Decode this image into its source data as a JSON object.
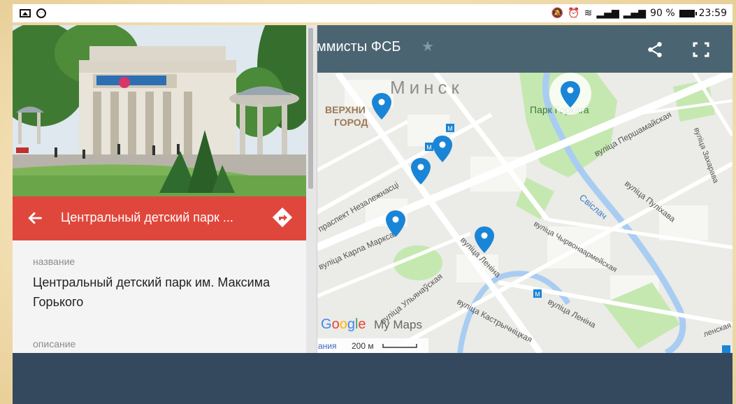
{
  "status_bar": {
    "icons": [
      "gallery-icon",
      "circle-dots-icon",
      "mute-icon",
      "alarm-icon",
      "wifi-icon",
      "signal-icon",
      "signal-icon",
      "battery-icon"
    ],
    "battery": "90 %",
    "time": "23:59"
  },
  "map_header": {
    "title": "ммисты ФСБ",
    "icons": [
      "star-icon",
      "share-icon",
      "fullscreen-icon"
    ]
  },
  "map": {
    "labels": {
      "city": "Минск",
      "district_line1": "ВЕРХНИ",
      "district_line2": "ГОРОД",
      "park": "Парк Горкага",
      "street_pershamaiskaya": "вуліца Першамайская",
      "street_zakharava": "вуліца Захарава",
      "street_pulikhava": "вуліца Пуліхава",
      "river": "Свіслач",
      "street_chyrvonaarmeiskaya": "вуліца Чырвонаармейская",
      "prospekt": "праспект Незалежнасці",
      "street_karla_marksa": "вуліца Карла Маркса",
      "street_lenina_1": "вуліца Леніна",
      "street_ulyanauskaya": "вуліца Ульянаўская",
      "street_lenina_2": "вуліца Леніна",
      "street_kastrychnitskaya": "вуліца Кастрычніцкая",
      "street_edge": "ленская",
      "metro": "М",
      "attribution_partial": "ания",
      "scale": "200 м"
    },
    "google": {
      "g1": "G",
      "o1": "o",
      "o2": "o",
      "g2": "g",
      "l": "l",
      "e": "e"
    },
    "my_maps": "My Maps",
    "markers": 6
  },
  "panel": {
    "place_title": "Центральный детский парк ...",
    "name_label": "название",
    "name_value": "Центральный детский парк им. Максима Горького",
    "description_label": "описание"
  },
  "colors": {
    "map_header": "#4b6472",
    "title_bar": "#e0473c",
    "bottom_bar": "#34495e",
    "marker": "#1a85d6",
    "park": "#c5e8b0",
    "river": "#a9cdf2"
  }
}
